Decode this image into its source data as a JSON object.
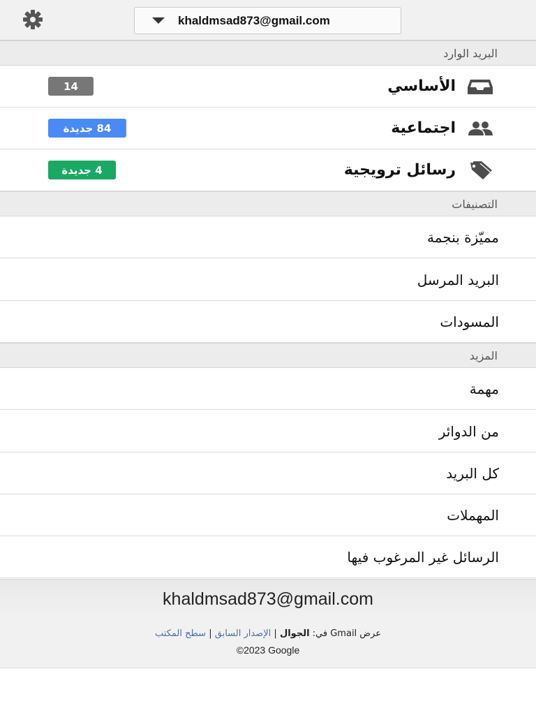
{
  "topbar": {
    "settings_icon": "gear-icon",
    "account_email": "khaldmsad873@gmail.com",
    "dropdown_icon": "caret-down-icon"
  },
  "inbox_section": {
    "title": "البريد الوارد",
    "items": [
      {
        "label": "الأساسي",
        "icon": "inbox-tray-icon",
        "badge": "14",
        "badge_color": "#777777"
      },
      {
        "label": "اجتماعية",
        "icon": "people-icon",
        "badge": "84 جديدة",
        "badge_color": "#4a8af4"
      },
      {
        "label": "رسائل ترويجية",
        "icon": "tag-icon",
        "badge": "4 جديدة",
        "badge_color": "#1aa865"
      }
    ]
  },
  "labels_section": {
    "title": "التصنيفات",
    "items": [
      {
        "label": "مميّزة بنجمة"
      },
      {
        "label": "البريد المرسل"
      },
      {
        "label": "المسودات"
      }
    ]
  },
  "more_section": {
    "title": "المزيد",
    "items": [
      {
        "label": "مهمة"
      },
      {
        "label": "من الدوائر"
      },
      {
        "label": "كل البريد"
      },
      {
        "label": "المهملات"
      },
      {
        "label": "الرسائل غير المرغوب فيها"
      }
    ]
  },
  "footer": {
    "email": "khaldmsad873@gmail.com",
    "view_prefix": "عرض Gmail في:",
    "view_mobile": "الجوال",
    "separator": "|",
    "older_version": "الإصدار السابق",
    "desktop": "سطح المكتب",
    "copyright": "©2023 Google"
  }
}
